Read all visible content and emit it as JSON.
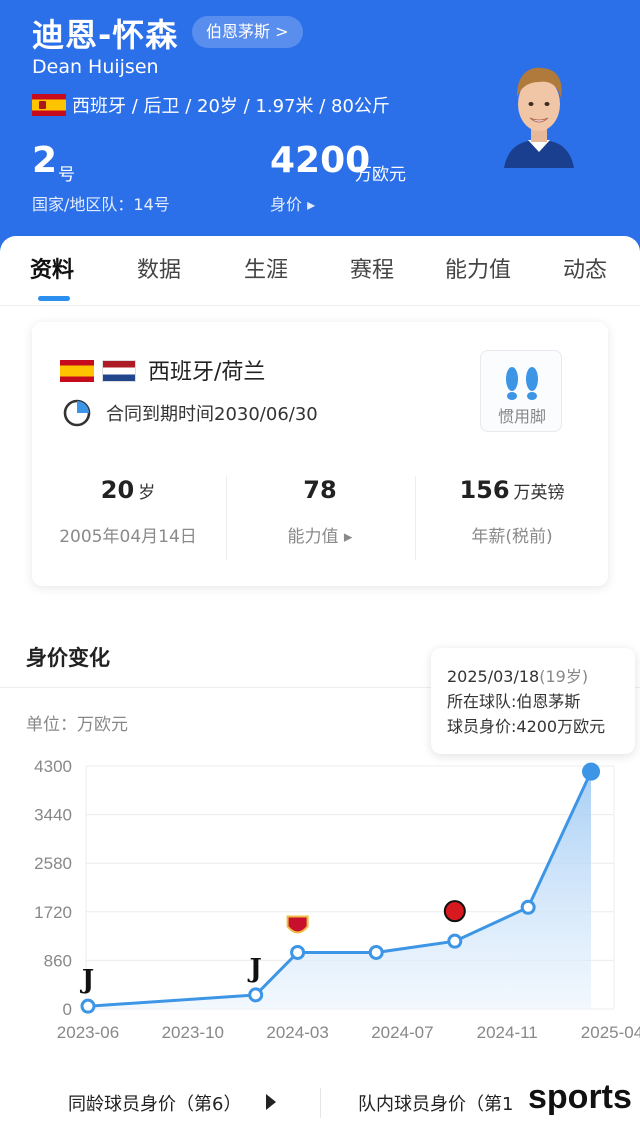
{
  "header": {
    "name_cn": "迪恩-怀森",
    "club_label": "伯恩茅斯 >",
    "name_en": "Dean Huijsen",
    "info_line": "西班牙 / 后卫 / 20岁 / 1.97米 / 80公斤",
    "shirt_number": "2",
    "shirt_unit": "号",
    "national_number": "国家/地区队：14号",
    "market_value": "4200",
    "market_value_unit": "万欧元",
    "market_value_label": "身价 ▸",
    "flag_icon": "spain-flag-icon",
    "avatar_icon": "player-photo"
  },
  "tabs": [
    {
      "label": "资料",
      "active": true
    },
    {
      "label": "数据"
    },
    {
      "label": "生涯"
    },
    {
      "label": "赛程"
    },
    {
      "label": "能力值"
    },
    {
      "label": "动态"
    }
  ],
  "card": {
    "nationality": "西班牙/荷兰",
    "contract": "合同到期时间2030/06/30",
    "foot_label": "惯用脚",
    "stats": [
      {
        "value": "20",
        "unit": "岁",
        "sub": "2005年04月14日"
      },
      {
        "value": "78",
        "unit": "",
        "sub": "能力值 ▸"
      },
      {
        "value": "156",
        "unit": "万英镑",
        "sub": "年薪(税前)"
      }
    ]
  },
  "value_section": {
    "title": "身价变化",
    "unit_label": "单位：万欧元",
    "tooltip": {
      "date": "2025/03/18",
      "age": "(19岁)",
      "team_line": "所在球队:伯恩茅斯",
      "value_line": "球员身价:4200万欧元"
    }
  },
  "chart_data": {
    "type": "line",
    "x_tick_labels": [
      "2023-06",
      "2023-10",
      "2024-03",
      "2024-07",
      "2024-11",
      "2025-04"
    ],
    "y_tick_labels": [
      "0",
      "860",
      "1720",
      "2580",
      "3440",
      "4300"
    ],
    "ylim": [
      0,
      4300
    ],
    "points": [
      {
        "x": "2023-06",
        "y": 50,
        "club_icon": "juventus-logo-icon"
      },
      {
        "x": "2024-01",
        "y": 250,
        "club_icon": "juventus-logo-icon"
      },
      {
        "x": "2024-03",
        "y": 1000,
        "club_icon": "roma-logo-icon"
      },
      {
        "x": "2024-06",
        "y": 1000
      },
      {
        "x": "2024-09",
        "y": 1200,
        "club_icon": "bournemouth-logo-icon"
      },
      {
        "x": "2024-12",
        "y": 1800
      },
      {
        "x": "2025-03",
        "y": 4200
      }
    ],
    "line_color": "#3d95e6",
    "fill_color": "#cfe4fa",
    "grid": true
  },
  "bottom": {
    "left_label": "同龄球员身价（第6）",
    "right_label": "队内球员身价（第1",
    "watermark": "sports"
  }
}
